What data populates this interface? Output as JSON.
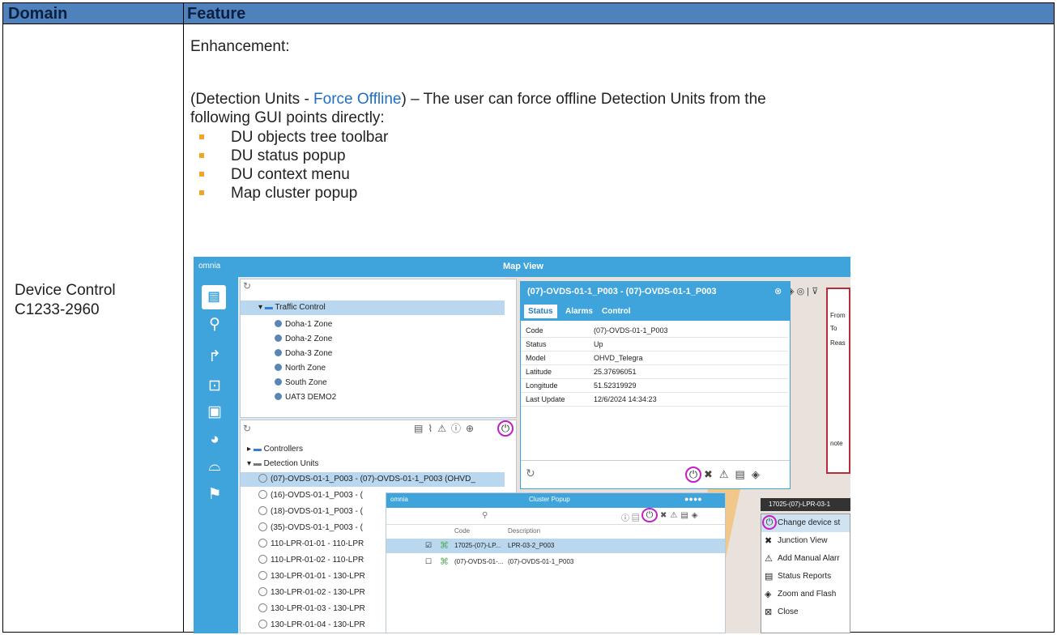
{
  "table": {
    "header_domain": "Domain",
    "header_feature": "Feature",
    "domain_line1": "Device Control",
    "domain_line2": "C1233-2960",
    "enh": "Enhancement:",
    "para_a": "(Detection Units - ",
    "para_link": "Force Offline",
    "para_b": ") – The user can force offline Detection Units from the",
    "para_c": "following GUI points directly:",
    "bullets": [
      "DU objects tree toolbar",
      "DU status popup",
      "DU context menu",
      "Map cluster popup"
    ]
  },
  "shot": {
    "brand": "omnia",
    "title": "Map View",
    "tree_root": "Traffic Control",
    "zones": [
      "Doha-1 Zone",
      "Doha-2 Zone",
      "Doha-3 Zone",
      "North Zone",
      "South Zone",
      "UAT3 DEMO2"
    ],
    "controllers": "Controllers",
    "detection_units": "Detection Units",
    "du_rows": [
      "(07)-OVDS-01-1_P003 - (07)-OVDS-01-1_P003 (OHVD_",
      "(16)-OVDS-01-1_P003 - (",
      "(18)-OVDS-01-1_P003 - (",
      "(35)-OVDS-01-1_P003 - (",
      "110-LPR-01-01 - 110-LPR",
      "110-LPR-01-02 - 110-LPR",
      "130-LPR-01-01 - 130-LPR",
      "130-LPR-01-02 - 130-LPR",
      "130-LPR-01-03 - 130-LPR",
      "130-LPR-01-04 - 130-LPR"
    ],
    "popup_title": "(07)-OVDS-01-1_P003 - (07)-OVDS-01-1_P003",
    "tabs": [
      "Status",
      "Alarms",
      "Control"
    ],
    "keys": [
      "Code",
      "Status",
      "Model",
      "Latitude",
      "Longitude",
      "Last Update"
    ],
    "vals": [
      "(07)-OVDS-01-1_P003",
      "Up",
      "OHVD_Telegra",
      "25.37696051",
      "51.52319929",
      "12/6/2024 14:34:23"
    ],
    "map_labels": [
      "From",
      "To",
      "Reas",
      "note"
    ],
    "cluster_title": "Cluster Popup",
    "cluster_cols": [
      "Code",
      "Description"
    ],
    "cluster_rows": [
      [
        "17025-(07)-LP...",
        "LPR-03-2_P003"
      ],
      [
        "(07)-OVDS-01-...",
        "(07)-OVDS-01-1_P003"
      ]
    ],
    "ctx_header": "17025-(07)-LPR-03-1",
    "ctx_items": [
      "Change device st",
      "Junction View",
      "Add Manual Alarr",
      "Status Reports",
      "Zoom and Flash",
      "Close"
    ]
  }
}
